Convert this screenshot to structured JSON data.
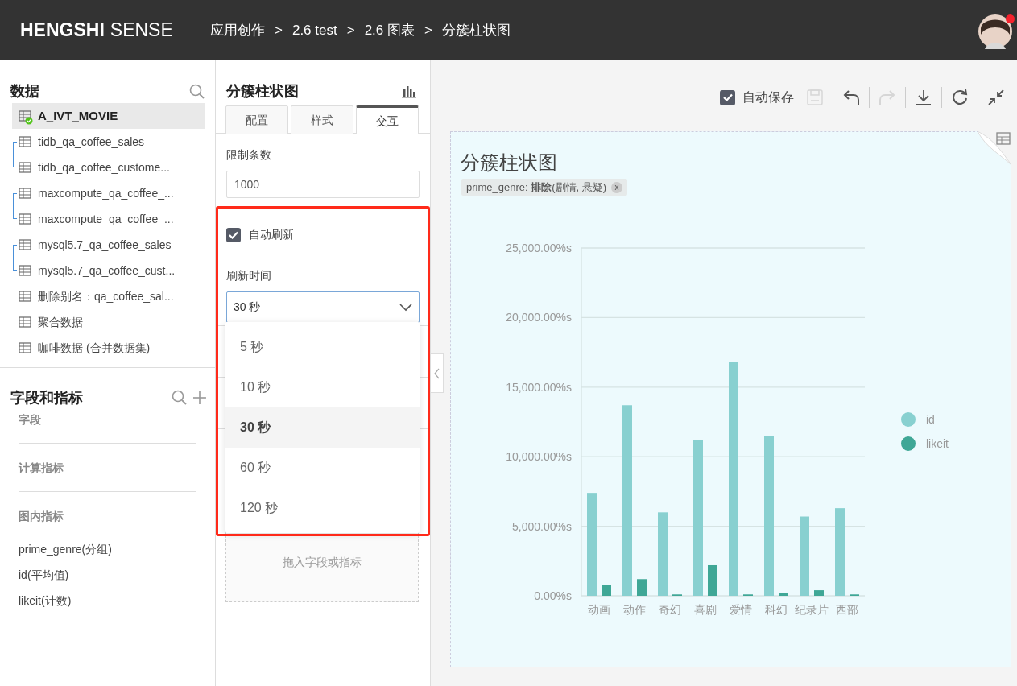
{
  "header": {
    "logo_bold": "HENGSHI",
    "logo_light": "SENSE",
    "breadcrumb": [
      {
        "label": "应用创作"
      },
      {
        "separator": ">",
        "label": "2.6 test"
      },
      {
        "separator": ">",
        "label": "2.6 图表"
      },
      {
        "separator": ">",
        "label": "分簇柱状图"
      }
    ],
    "notification": true
  },
  "data_panel": {
    "title": "数据",
    "items": [
      {
        "kind": "table",
        "name": "A_IVT_MOVIE",
        "selected": true,
        "verified": true
      },
      {
        "kind": "group",
        "children": [
          {
            "kind": "table",
            "name": "tidb_qa_coffee_sales",
            "selected": false,
            "verified": false
          },
          {
            "kind": "table",
            "name": "tidb_qa_coffee_custome...",
            "selected": false,
            "verified": false
          }
        ]
      },
      {
        "kind": "group",
        "children": [
          {
            "kind": "table",
            "name": "maxcompute_qa_coffee_...",
            "selected": false,
            "verified": false
          },
          {
            "kind": "table",
            "name": "maxcompute_qa_coffee_...",
            "selected": false,
            "verified": false
          }
        ]
      },
      {
        "kind": "group",
        "children": [
          {
            "kind": "table",
            "name": "mysql5.7_qa_coffee_sales",
            "selected": false,
            "verified": false
          },
          {
            "kind": "table",
            "name": "mysql5.7_qa_coffee_cust...",
            "selected": false,
            "verified": false
          }
        ]
      },
      {
        "kind": "table",
        "name": "删除别名：qa_coffee_sal...",
        "selected": false,
        "verified": false
      },
      {
        "kind": "table",
        "name": "聚合数据",
        "selected": false,
        "verified": false
      },
      {
        "kind": "table",
        "name": "咖啡数据 (合并数据集)",
        "selected": false,
        "verified": false
      }
    ]
  },
  "fields_panel": {
    "title": "字段和指标",
    "sections": [
      {
        "title": "字段"
      },
      {
        "title": "计算指标"
      },
      {
        "title": "图内指标",
        "items": [
          "prime_genre(分组)",
          "id(平均值)",
          "likeit(计数)"
        ]
      }
    ]
  },
  "config_panel": {
    "title": "分簇柱状图",
    "tabs": [
      {
        "label": "配置",
        "selected": false
      },
      {
        "label": "样式",
        "selected": false
      },
      {
        "label": "交互",
        "selected": true
      }
    ],
    "limit": {
      "label": "限制条数",
      "value": "1000"
    },
    "auto_refresh": {
      "label": "自动刷新",
      "checked": true
    },
    "refresh_time": {
      "label": "刷新时间",
      "value": "30 秒",
      "expanded": true,
      "options": [
        {
          "label": "5 秒",
          "selected": false
        },
        {
          "label": "10 秒",
          "selected": false
        },
        {
          "label": "30 秒",
          "selected": true
        },
        {
          "label": "60 秒",
          "selected": false
        },
        {
          "label": "120 秒",
          "selected": false
        }
      ]
    },
    "drop_zone": "拖入字段或指标"
  },
  "toolbar": {
    "autosave": {
      "label": "自动保存",
      "checked": true
    },
    "buttons": [
      {
        "kind": "save",
        "disabled": true
      },
      {
        "kind": "undo",
        "disabled": false
      },
      {
        "kind": "redo",
        "disabled": true
      },
      {
        "kind": "download",
        "disabled": false
      },
      {
        "kind": "refresh",
        "disabled": false
      },
      {
        "kind": "collapse",
        "disabled": false
      }
    ]
  },
  "chart_card": {
    "title": "分簇柱状图",
    "filter": {
      "text": "prime_genre: **排除**(剧情, 悬疑)",
      "close": "x"
    },
    "chart_data": {
      "type": "bar",
      "categories": [
        "动画",
        "动作",
        "奇幻",
        "喜剧",
        "爱情",
        "科幻",
        "纪录片",
        "西部"
      ],
      "series": [
        {
          "name": "id",
          "color": "#88d0d0",
          "values": [
            7400,
            13700,
            6000,
            11200,
            16800,
            11500,
            5700,
            6300
          ]
        },
        {
          "name": "likeit",
          "color": "#3fa796",
          "values": [
            800,
            1200,
            100,
            2200,
            100,
            200,
            400,
            100
          ]
        }
      ],
      "grid": true,
      "legend": true,
      "ylim": [
        0,
        25000
      ],
      "yticks": [
        {
          "value": 0,
          "label": "0.00%s"
        },
        {
          "value": 5000,
          "label": "5,000.00%s"
        },
        {
          "value": 10000,
          "label": "10,000.00%s"
        },
        {
          "value": 15000,
          "label": "15,000.00%s"
        },
        {
          "value": 20000,
          "label": "20,000.00%s"
        },
        {
          "value": 25000,
          "label": "25,000.00%s"
        }
      ]
    }
  }
}
